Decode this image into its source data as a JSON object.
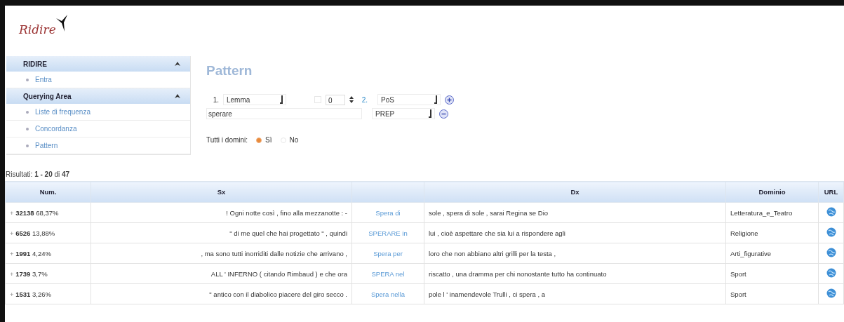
{
  "logo": {
    "text": "Ridire"
  },
  "sidebar": [
    {
      "title": "RIDIRE",
      "expanded": true,
      "items": [
        "Entra"
      ]
    },
    {
      "title": "Querying Area",
      "expanded": true,
      "items": [
        "Liste di frequenza",
        "Concordanza",
        "Pattern"
      ]
    }
  ],
  "pattern": {
    "title": "Pattern",
    "slot1": {
      "index": "1.",
      "type": "Lemma",
      "value": "sperare"
    },
    "distance": {
      "checked": false,
      "value": "0"
    },
    "slot2": {
      "index": "2.",
      "type": "PoS",
      "value": "PREP"
    },
    "domains": {
      "label": "Tutti i domini:",
      "options": [
        {
          "label": "Sì",
          "selected": true
        },
        {
          "label": "No",
          "selected": false
        }
      ]
    }
  },
  "results": {
    "label": "Risultati:",
    "range": "1 - 20",
    "of": "di",
    "total": "47"
  },
  "table": {
    "columns": [
      "Num.",
      "Sx",
      "",
      "Dx",
      "Dominio",
      "URL"
    ],
    "rows": [
      {
        "toggle": "+",
        "num": "32138",
        "pct": "68,37%",
        "sx": "! Ogni notte così , fino alla mezzanotte : -",
        "kw": "Spera di",
        "dx": "sole , spera di sole , sarai Regina se Dio",
        "dominio": "Letteratura_e_Teatro"
      },
      {
        "toggle": "+",
        "num": "6526",
        "pct": "13,88%",
        "sx": "\" di me quel che hai progettato \" , quindi",
        "kw": "SPERARE in",
        "dx": "lui , cioè aspettare che sia lui a rispondere agli",
        "dominio": "Religione"
      },
      {
        "toggle": "+",
        "num": "1991",
        "pct": "4,24%",
        "sx": ", ma sono tutti inorriditi dalle notizie che arrivano ,",
        "kw": "Spera per",
        "dx": "loro che non abbiano altri grilli per la testa ,",
        "dominio": "Arti_figurative"
      },
      {
        "toggle": "+",
        "num": "1739",
        "pct": "3,7%",
        "sx": "ALL ' INFERNO ( citando Rimbaud ) e che ora",
        "kw": "SPERA nel",
        "dx": "riscatto , una dramma per chi nonostante tutto ha continuato",
        "dominio": "Sport"
      },
      {
        "toggle": "+",
        "num": "1531",
        "pct": "3,26%",
        "sx": "\" antico con il diabolico piacere del giro secco .",
        "kw": "Spera nella",
        "dx": "pole l ' inamendevole Trulli , ci spera , a",
        "dominio": "Sport"
      }
    ]
  }
}
